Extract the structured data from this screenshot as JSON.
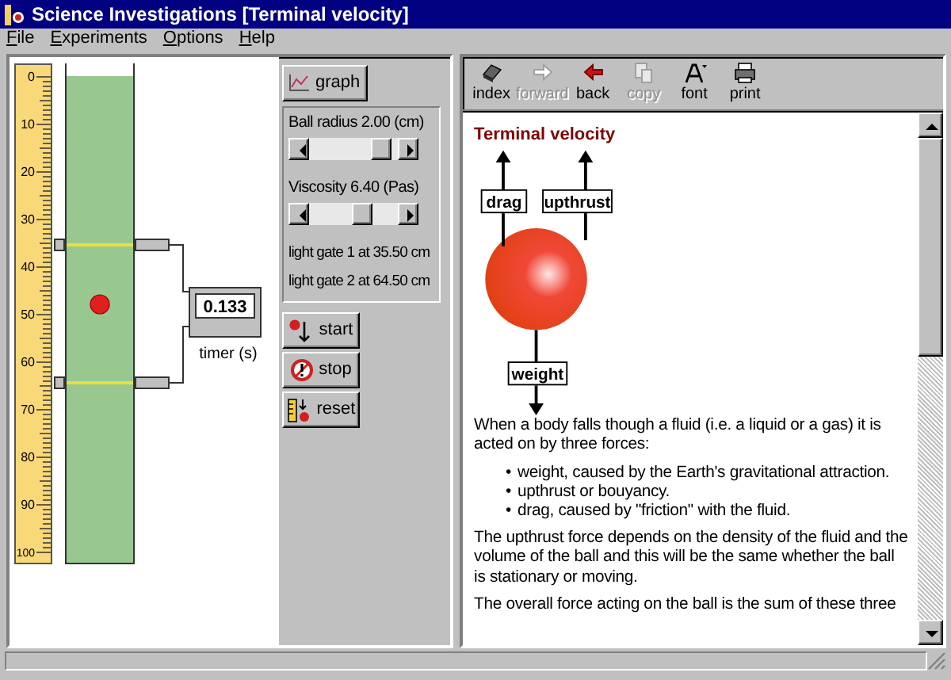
{
  "window": {
    "title": "Science Investigations [Terminal velocity]"
  },
  "menu": [
    "File",
    "Experiments",
    "Options",
    "Help"
  ],
  "simulation": {
    "scale_labels": [
      "0",
      "10",
      "20",
      "30",
      "40",
      "50",
      "60",
      "70",
      "80",
      "90",
      "100"
    ],
    "timer": {
      "value": "0.133",
      "label": "timer (s)"
    }
  },
  "controls": {
    "graph_button": "graph",
    "sliders": [
      {
        "label": "Ball radius 2.00 (cm)",
        "level": 0.9
      },
      {
        "label": "Viscosity 6.40 (Pas)",
        "level": 0.62
      }
    ],
    "gates": [
      "light gate 1 at 35.50 cm",
      "light gate 2 at 64.50 cm"
    ],
    "buttons": [
      {
        "label": "start",
        "kind": "start"
      },
      {
        "label": "stop",
        "kind": "stop"
      },
      {
        "label": "reset",
        "kind": "reset"
      }
    ]
  },
  "toolbar": [
    {
      "label": "index",
      "kind": "index",
      "disabled": false
    },
    {
      "label": "forward",
      "kind": "forward",
      "disabled": true
    },
    {
      "label": "back",
      "kind": "back",
      "disabled": false
    },
    {
      "label": "copy",
      "kind": "copy",
      "disabled": true
    },
    {
      "label": "font",
      "kind": "font",
      "disabled": false
    },
    {
      "label": "print",
      "kind": "print",
      "disabled": false
    }
  ],
  "document": {
    "heading": "Terminal velocity",
    "diagram_labels": {
      "drag": "drag",
      "upthrust": "upthrust",
      "weight": "weight"
    },
    "blocks": [
      {
        "kind": "paragraph",
        "text": "When a body falls though a fluid (i.e. a liquid or a gas) it is acted on by three forces:"
      },
      {
        "kind": "list",
        "marker": "•",
        "items": [
          "weight, caused by the Earth's gravitational attraction.",
          "upthrust or bouyancy.",
          "drag, caused by \"friction\" with the fluid."
        ]
      },
      {
        "kind": "paragraph",
        "text": "The upthrust force depends on the density of the fluid and the volume of the ball and this will be the same whether the ball is stationary or moving."
      },
      {
        "kind": "paragraph",
        "text": "The overall force acting on the ball is the sum of these three"
      }
    ]
  }
}
